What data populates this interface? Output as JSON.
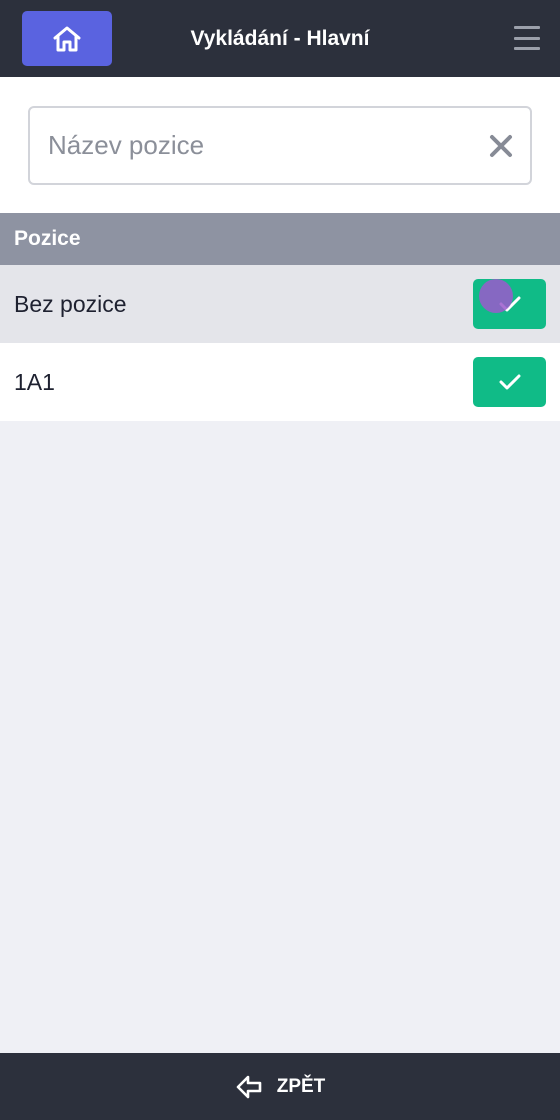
{
  "header": {
    "title": "Vykládání - Hlavní",
    "home_icon": "home-icon",
    "menu_icon": "hamburger-menu-icon"
  },
  "search": {
    "placeholder": "Název pozice",
    "value": "",
    "clear_icon": "close-icon"
  },
  "table": {
    "header": "Pozice",
    "rows": [
      {
        "label": "Bez pozice",
        "action_icon": "check-icon"
      },
      {
        "label": "1A1",
        "action_icon": "check-icon"
      }
    ]
  },
  "footer": {
    "back_label": "ZPĚT",
    "back_icon": "arrow-left-icon"
  },
  "colors": {
    "topbar": "#2c303c",
    "home_button": "#5a63e0",
    "check_button": "#10bb87",
    "table_header": "#8e93a2",
    "background": "#eff0f5"
  }
}
